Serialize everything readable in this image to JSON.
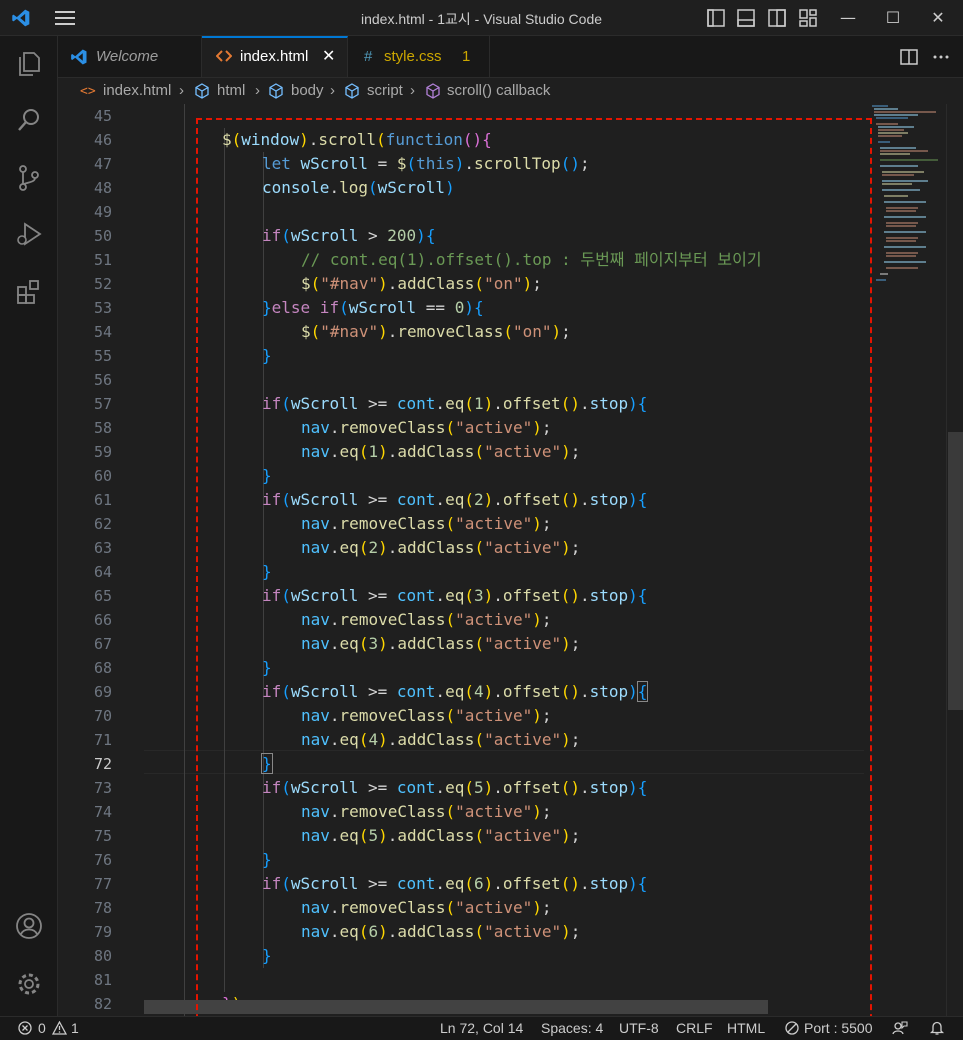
{
  "window": {
    "title": "index.html - 1교시 - Visual Studio Code",
    "minimize": "—",
    "maximize": "☐",
    "close": "✕"
  },
  "tabs": {
    "welcome": "Welcome",
    "index": "index.html",
    "style": "style.css",
    "style_problems": "1"
  },
  "breadcrumb": {
    "file": "index.html",
    "html": "html",
    "body": "body",
    "script": "script",
    "callback": "scroll() callback"
  },
  "editor": {
    "current_line": 72,
    "line_numbers": [
      "45",
      "46",
      "47",
      "48",
      "49",
      "50",
      "51",
      "52",
      "53",
      "54",
      "55",
      "56",
      "57",
      "58",
      "59",
      "60",
      "61",
      "62",
      "63",
      "64",
      "65",
      "66",
      "67",
      "68",
      "69",
      "70",
      "71",
      "72",
      "73",
      "74",
      "75",
      "76",
      "77",
      "78",
      "79",
      "80",
      "81",
      "82"
    ]
  },
  "status": {
    "errors": "0",
    "warnings": "1",
    "position": "Ln 72, Col 14",
    "spaces": "Spaces: 4",
    "encoding": "UTF-8",
    "eol": "CRLF",
    "language": "HTML",
    "port": "Port : 5500"
  },
  "colors": {
    "accent": "#0078d4",
    "highlight_box": "#e51400",
    "warning": "#cca700"
  },
  "icons": [
    "vscode-logo-icon",
    "menu-icon",
    "explorer-icon",
    "search-icon",
    "source-control-icon",
    "run-debug-icon",
    "extensions-icon",
    "account-icon",
    "settings-gear-icon",
    "split-editor-icon",
    "more-actions-icon",
    "error-icon",
    "warning-icon",
    "port-icon",
    "feedback-icon",
    "bell-icon"
  ]
}
